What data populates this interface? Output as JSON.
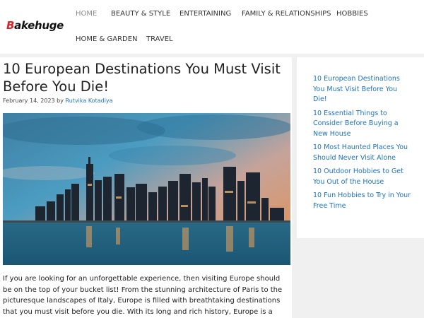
{
  "header": {
    "logo_initial": "B",
    "logo_rest": "akehuge",
    "nav": [
      {
        "label": "HOME",
        "active": true
      },
      {
        "label": "BEAUTY & STYLE",
        "active": false
      },
      {
        "label": "ENTERTAINING",
        "active": false
      },
      {
        "label": "FAMILY & RELATIONSHIPS",
        "active": false
      },
      {
        "label": "HOBBIES",
        "active": false
      },
      {
        "label": "HOME & GARDEN",
        "active": false
      },
      {
        "label": "TRAVEL",
        "active": false
      }
    ]
  },
  "article": {
    "title": "10 European Destinations You Must Visit Before You Die!",
    "date": "February 14, 2023",
    "by": "by",
    "author": "Rutvika Kotadiya",
    "intro": "If you are looking for an unforgettable experience, then visiting Europe should be on the top of your bucket list! From the stunning architecture of Paris to the picturesque landscapes of Italy, Europe is filled with breathtaking destinations that you must visit before you die. With its long and rich history, Europe is a"
  },
  "sidebar": {
    "links": [
      "10 European Destinations You Must Visit Before You Die!",
      "10 Essential Things to Consider Before Buying a New House",
      "10 Most Haunted Places You Should Never Visit Alone",
      "10 Outdoor Hobbies to Get You Out of the House",
      "10 Fun Hobbies to Try in Your Free Time"
    ]
  },
  "colors": {
    "link": "#1e73be",
    "logo_accent": "#d8232a",
    "background": "#f0f0f0"
  }
}
